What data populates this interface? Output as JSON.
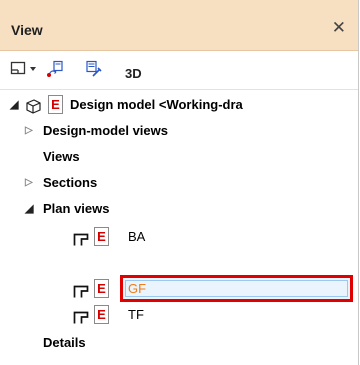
{
  "panel": {
    "title": "View",
    "close_icon": "close-icon"
  },
  "toolbar": {
    "view_3d_label": "3D"
  },
  "tree": {
    "root_label": "Design model <Working-dra",
    "items": [
      {
        "label": "Design-model views"
      },
      {
        "label": "Views"
      },
      {
        "label": "Sections"
      },
      {
        "label": "Plan views"
      },
      {
        "label": "BA"
      },
      {
        "label": "GF"
      },
      {
        "label": "TF"
      },
      {
        "label": "Details"
      }
    ],
    "e_letter": "E"
  },
  "colors": {
    "title_bg": "#f7dfc2",
    "selection_border": "#e00000",
    "selected_text": "#f07d16",
    "e_icon_red": "#d40000"
  }
}
